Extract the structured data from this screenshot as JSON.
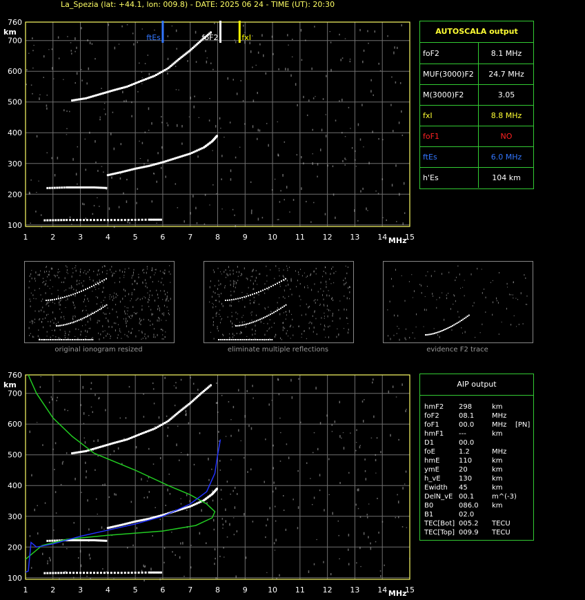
{
  "header": {
    "title": "La_Spezia (lat: +44.1, lon: 009.8) - DATE: 2025 06 24 - TIME (UT): 20:30"
  },
  "colors": {
    "grid": "#707070",
    "axis": "#ffff66",
    "foF2_marker": "#ffffff",
    "fxI_marker": "#ffff00",
    "ftEs_marker": "#3377ff",
    "profile_blue": "#2233ff",
    "profile_green": "#22cc22",
    "box_border": "#33cc33"
  },
  "top_chart": {
    "markers": [
      {
        "label": "ftEs",
        "freq": 6.0,
        "color": "#3377ff"
      },
      {
        "label": "foF2",
        "freq": 8.1,
        "color": "#ffffff"
      },
      {
        "label": "fxI",
        "freq": 8.8,
        "color": "#ffff00"
      }
    ]
  },
  "chart_data": [
    {
      "type": "scatter",
      "title": "",
      "xlabel": "MHz",
      "ylabel": "km",
      "xlim": [
        1,
        15
      ],
      "ylim": [
        95,
        760
      ],
      "x_ticks": [
        1,
        2,
        3,
        4,
        5,
        6,
        7,
        8,
        9,
        10,
        11,
        12,
        13,
        14,
        15
      ],
      "y_ticks": [
        100,
        200,
        300,
        400,
        500,
        600,
        700,
        760
      ],
      "series": [
        {
          "points": [
            [
              1.7,
              115
            ],
            [
              2.5,
              116
            ],
            [
              3.5,
              116
            ],
            [
              4.5,
              116
            ],
            [
              5.5,
              117
            ],
            [
              6.0,
              117
            ]
          ]
        },
        {
          "points": [
            [
              1.8,
              220
            ],
            [
              2.5,
              222
            ],
            [
              3.0,
              222
            ],
            [
              3.5,
              222
            ],
            [
              4.0,
              220
            ]
          ]
        },
        {
          "points": [
            [
              4.0,
              262
            ],
            [
              4.5,
              272
            ],
            [
              5.0,
              283
            ],
            [
              5.5,
              292
            ],
            [
              6.0,
              304
            ],
            [
              6.5,
              318
            ],
            [
              7.0,
              332
            ],
            [
              7.5,
              352
            ],
            [
              7.8,
              372
            ],
            [
              8.0,
              392
            ]
          ]
        },
        {
          "points": [
            [
              2.7,
              505
            ],
            [
              3.2,
              512
            ],
            [
              3.7,
              525
            ],
            [
              4.2,
              538
            ],
            [
              4.7,
              550
            ],
            [
              5.2,
              568
            ],
            [
              5.7,
              585
            ],
            [
              6.2,
              610
            ],
            [
              6.6,
              640
            ],
            [
              7.0,
              668
            ],
            [
              7.4,
              700
            ],
            [
              7.8,
              730
            ]
          ]
        }
      ]
    },
    {
      "type": "line",
      "title": "",
      "xlabel": "MHz",
      "ylabel": "km",
      "xlim": [
        1,
        15
      ],
      "ylim": [
        95,
        760
      ],
      "x_ticks": [
        1,
        2,
        3,
        4,
        5,
        6,
        7,
        8,
        9,
        10,
        11,
        12,
        13,
        14,
        15
      ],
      "y_ticks": [
        100,
        200,
        300,
        400,
        500,
        600,
        700,
        760
      ],
      "series": [
        {
          "points": [
            [
              1.7,
              115
            ],
            [
              2.5,
              116
            ],
            [
              3.5,
              116
            ],
            [
              4.5,
              116
            ],
            [
              5.5,
              117
            ],
            [
              6.0,
              117
            ]
          ]
        },
        {
          "points": [
            [
              1.8,
              220
            ],
            [
              2.5,
              222
            ],
            [
              3.0,
              222
            ],
            [
              3.5,
              222
            ],
            [
              4.0,
              220
            ]
          ]
        },
        {
          "points": [
            [
              4.0,
              262
            ],
            [
              4.5,
              272
            ],
            [
              5.0,
              283
            ],
            [
              5.5,
              292
            ],
            [
              6.0,
              304
            ],
            [
              6.5,
              318
            ],
            [
              7.0,
              332
            ],
            [
              7.5,
              352
            ],
            [
              7.8,
              372
            ],
            [
              8.0,
              392
            ]
          ]
        },
        {
          "points": [
            [
              2.7,
              505
            ],
            [
              3.2,
              512
            ],
            [
              3.7,
              525
            ],
            [
              4.2,
              538
            ],
            [
              4.7,
              550
            ],
            [
              5.2,
              568
            ],
            [
              5.7,
              585
            ],
            [
              6.2,
              610
            ],
            [
              6.6,
              640
            ],
            [
              7.0,
              668
            ],
            [
              7.4,
              700
            ],
            [
              7.8,
              730
            ]
          ]
        },
        {
          "points": [
            [
              1.1,
              760
            ],
            [
              1.4,
              700
            ],
            [
              2.0,
              620
            ],
            [
              2.7,
              560
            ],
            [
              3.5,
              505
            ],
            [
              5.0,
              450
            ],
            [
              6.2,
              400
            ],
            [
              7.0,
              370
            ],
            [
              7.6,
              340
            ],
            [
              7.9,
              315
            ],
            [
              7.8,
              295
            ],
            [
              7.2,
              270
            ],
            [
              6.0,
              252
            ],
            [
              4.0,
              238
            ],
            [
              2.5,
              225
            ],
            [
              1.6,
              205
            ],
            [
              1.0,
              160
            ]
          ]
        },
        {
          "points": [
            [
              1.0,
              118
            ],
            [
              1.1,
              122
            ],
            [
              1.2,
              215
            ],
            [
              1.4,
              200
            ],
            [
              2.0,
              210
            ],
            [
              3.0,
              235
            ],
            [
              4.0,
              255
            ],
            [
              5.0,
              275
            ],
            [
              6.0,
              300
            ],
            [
              7.0,
              340
            ],
            [
              7.6,
              380
            ],
            [
              7.9,
              440
            ],
            [
              8.0,
              500
            ],
            [
              8.1,
              550
            ]
          ]
        }
      ]
    }
  ],
  "thumbs": [
    {
      "caption": "original ionogram resized"
    },
    {
      "caption": "eliminate multiple reflections"
    },
    {
      "caption": "evidence F2 trace"
    }
  ],
  "autoscala": {
    "title": "AUTOSCALA output",
    "rows": [
      {
        "label": "foF2",
        "value": "8.1 MHz",
        "color": "#ffffff"
      },
      {
        "label": "MUF(3000)F2",
        "value": "24.7 MHz",
        "color": "#ffffff"
      },
      {
        "label": "M(3000)F2",
        "value": "3.05",
        "color": "#ffffff"
      },
      {
        "label": "fxI",
        "value": "8.8 MHz",
        "color": "#ffff33"
      },
      {
        "label": "foF1",
        "value": "NO",
        "color": "#ff2222"
      },
      {
        "label": "ftEs",
        "value": "6.0 MHz",
        "color": "#3377ff"
      },
      {
        "label": "h'Es",
        "value": "104     km",
        "color": "#ffffff"
      }
    ]
  },
  "aip": {
    "title": "AIP output",
    "rows": [
      {
        "name": "hmF2",
        "value": "298",
        "unit": "km",
        "extra": ""
      },
      {
        "name": "foF2",
        "value": "08.1",
        "unit": "MHz",
        "extra": ""
      },
      {
        "name": "foF1",
        "value": "00.0",
        "unit": "MHz",
        "extra": "[PN]"
      },
      {
        "name": "hmF1",
        "value": "---",
        "unit": "km",
        "extra": ""
      },
      {
        "name": "D1",
        "value": "00.0",
        "unit": "",
        "extra": ""
      },
      {
        "name": "foE",
        "value": "1.2",
        "unit": "MHz",
        "extra": ""
      },
      {
        "name": "hmE",
        "value": "110",
        "unit": "km",
        "extra": ""
      },
      {
        "name": "ymE",
        "value": "20",
        "unit": "km",
        "extra": ""
      },
      {
        "name": "h_vE",
        "value": "130",
        "unit": "km",
        "extra": ""
      },
      {
        "name": "Ewidth",
        "value": "45",
        "unit": "km",
        "extra": ""
      },
      {
        "name": "DelN_vE",
        "value": "00.1",
        "unit": "m^(-3)",
        "extra": ""
      },
      {
        "name": "B0",
        "value": "086.0",
        "unit": "km",
        "extra": ""
      },
      {
        "name": "B1",
        "value": "02.0",
        "unit": "",
        "extra": ""
      },
      {
        "name": "TEC[Bot]",
        "value": "005.2",
        "unit": "TECU",
        "extra": ""
      },
      {
        "name": "TEC[Top]",
        "value": "009.9",
        "unit": "TECU",
        "extra": ""
      }
    ]
  }
}
